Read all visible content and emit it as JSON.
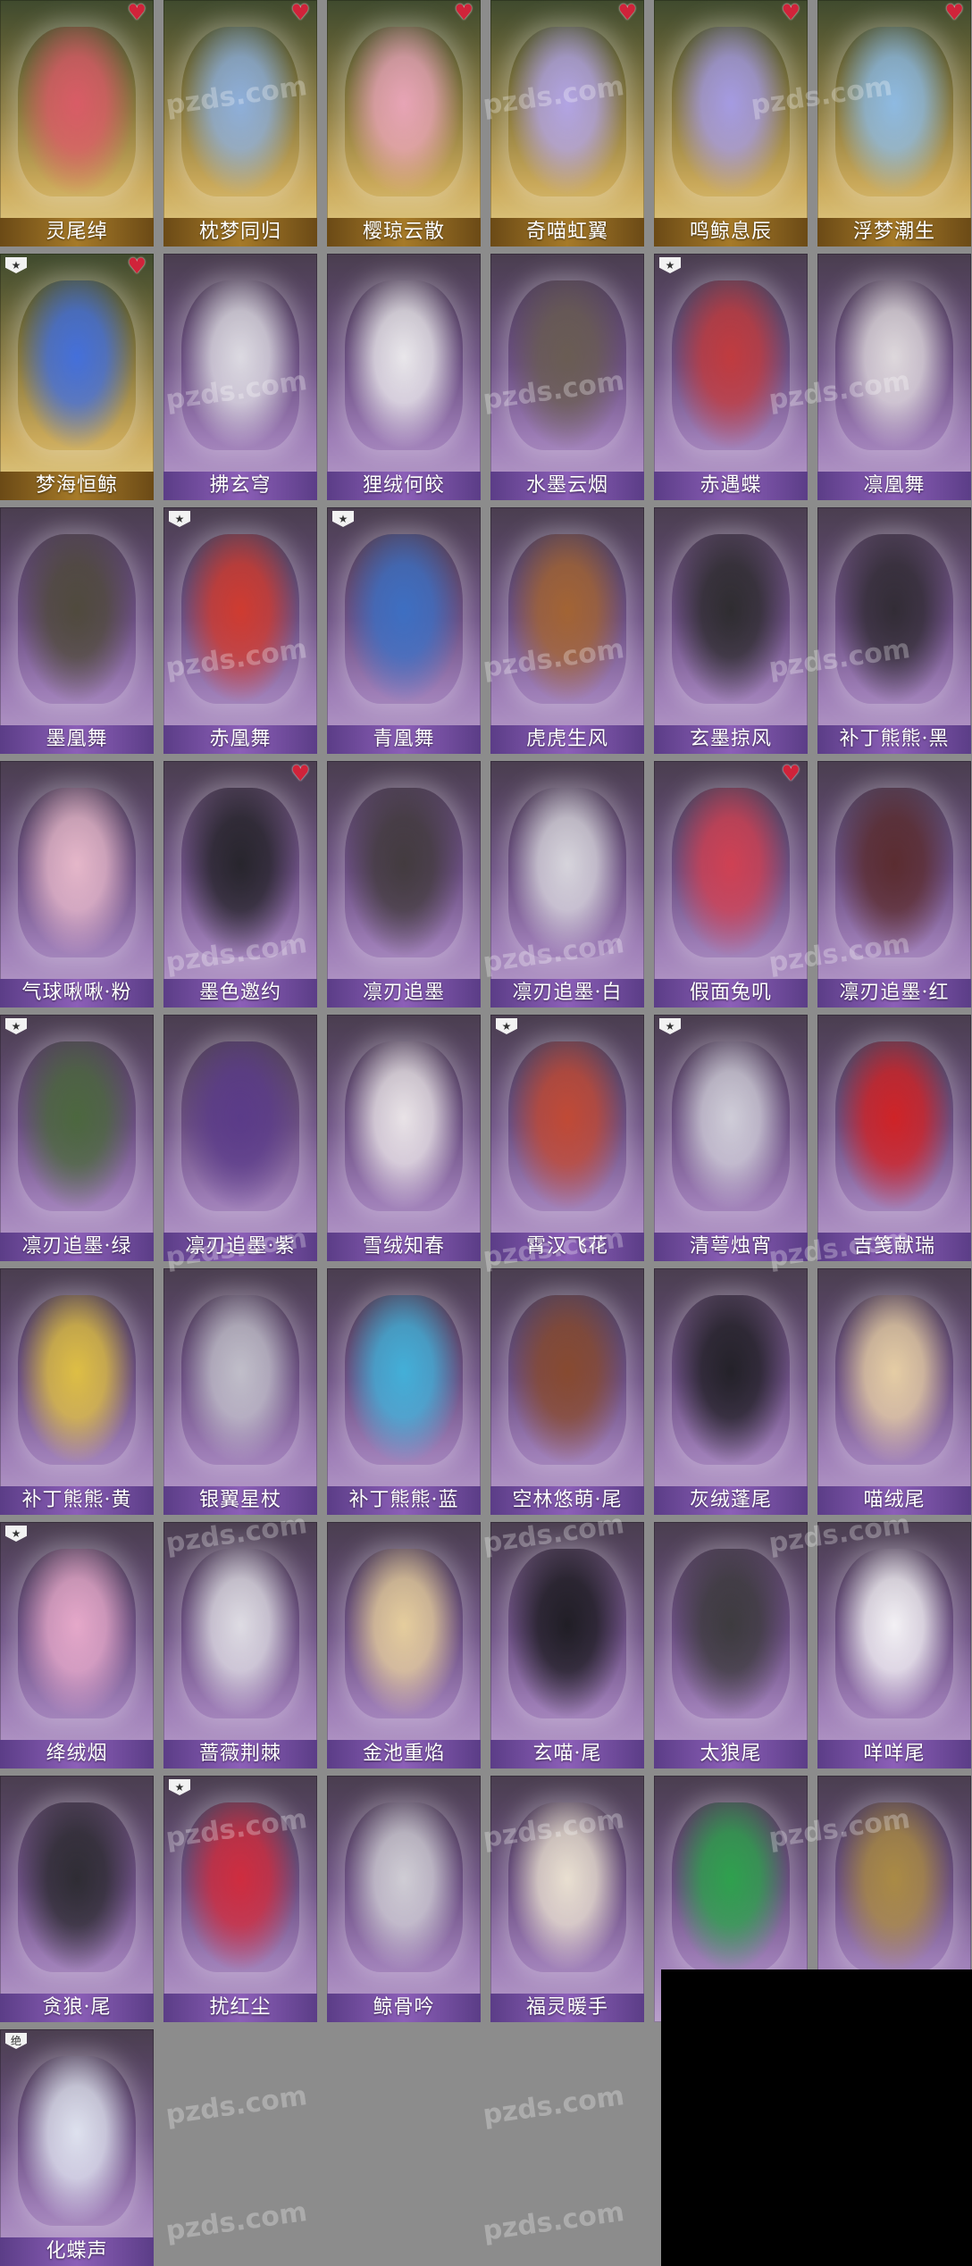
{
  "watermark": "pzds.com",
  "badges": {
    "tag": "★",
    "new": "绝"
  },
  "items": [
    {
      "label": "灵尾绰",
      "heart": true,
      "gold": true,
      "color": "#e05a6a"
    },
    {
      "label": "枕梦同归",
      "heart": true,
      "gold": true,
      "color": "#8fb4e8"
    },
    {
      "label": "樱琼云散",
      "heart": true,
      "gold": true,
      "color": "#f0a8c0"
    },
    {
      "label": "奇喵虹翼",
      "heart": true,
      "gold": true,
      "color": "#b6a8f2"
    },
    {
      "label": "鸣鲸息辰",
      "heart": true,
      "gold": true,
      "color": "#a89ef0"
    },
    {
      "label": "浮梦潮生",
      "heart": true,
      "gold": true,
      "color": "#8fc0f0"
    },
    {
      "label": "梦海恒鲸",
      "heart": true,
      "gold": true,
      "badge": true,
      "color": "#3f6fe8"
    },
    {
      "label": "拂玄穹",
      "color": "#e6e6ea"
    },
    {
      "label": "狸绒何皎",
      "color": "#f4f4f4"
    },
    {
      "label": "水墨云烟",
      "color": "#6a5e50"
    },
    {
      "label": "赤遇蝶",
      "badge": true,
      "color": "#c83a3a"
    },
    {
      "label": "凛凰舞",
      "color": "#e8e4e4"
    },
    {
      "label": "墨凰舞",
      "color": "#4e4a38"
    },
    {
      "label": "赤凰舞",
      "badge": true,
      "color": "#d83a2a"
    },
    {
      "label": "青凰舞",
      "badge": true,
      "color": "#3a72c8"
    },
    {
      "label": "虎虎生风",
      "color": "#a8662e"
    },
    {
      "label": "玄墨掠风",
      "color": "#2a2a2a"
    },
    {
      "label": "补丁熊熊·黑",
      "color": "#2e2a30"
    },
    {
      "label": "气球啾啾·粉",
      "color": "#f0c0d0"
    },
    {
      "label": "墨色邀约",
      "heart": true,
      "color": "#222226"
    },
    {
      "label": "凛刃追墨",
      "color": "#403a3a"
    },
    {
      "label": "凛刃追墨·白",
      "color": "#e0e0e4"
    },
    {
      "label": "假面兔叽",
      "heart": true,
      "color": "#d84050"
    },
    {
      "label": "凛刃追墨·红",
      "color": "#5a2a2a"
    },
    {
      "label": "凛刃追墨·绿",
      "badge": true,
      "color": "#4a6a3a"
    },
    {
      "label": "凛刃追墨·紫",
      "color": "#5a3a8a"
    },
    {
      "label": "雪绒知春",
      "color": "#f4f0f0"
    },
    {
      "label": "霄汉飞花",
      "badge": true,
      "color": "#c84a30"
    },
    {
      "label": "清萼烛宵",
      "badge": true,
      "color": "#d8d8e0"
    },
    {
      "label": "吉笺献瑞",
      "color": "#d82020"
    },
    {
      "label": "补丁熊熊·黄",
      "color": "#e8c840"
    },
    {
      "label": "银翼星杖",
      "color": "#c8c8d0"
    },
    {
      "label": "补丁熊熊·蓝",
      "color": "#40b8e0"
    },
    {
      "label": "空林悠萌·尾",
      "color": "#8a4a2a"
    },
    {
      "label": "灰绒蓬尾",
      "color": "#1e1e22"
    },
    {
      "label": "喵绒尾",
      "color": "#f0d8a8"
    },
    {
      "label": "绛绒烟",
      "badge": true,
      "color": "#f0b0d0"
    },
    {
      "label": "蔷薇荆棘",
      "color": "#e8e8ec"
    },
    {
      "label": "金池重焰",
      "color": "#f0d8a0"
    },
    {
      "label": "玄喵·尾",
      "color": "#1a1a1e"
    },
    {
      "label": "太狼尾",
      "color": "#3a3a3a"
    },
    {
      "label": "咩咩尾",
      "color": "#ffffff"
    },
    {
      "label": "贪狼·尾",
      "color": "#2a2a2e"
    },
    {
      "label": "扰红尘",
      "badge": true,
      "color": "#d82a3a"
    },
    {
      "label": "鲸骨吟",
      "color": "#d8d8dc"
    },
    {
      "label": "福灵暖手",
      "color": "#f4ecd8"
    },
    {
      "label": "",
      "color": "#2aa84a"
    },
    {
      "label": "",
      "color": "#b09040"
    },
    {
      "label": "化蝶声",
      "badge": true,
      "color": "#e8eef8"
    }
  ]
}
